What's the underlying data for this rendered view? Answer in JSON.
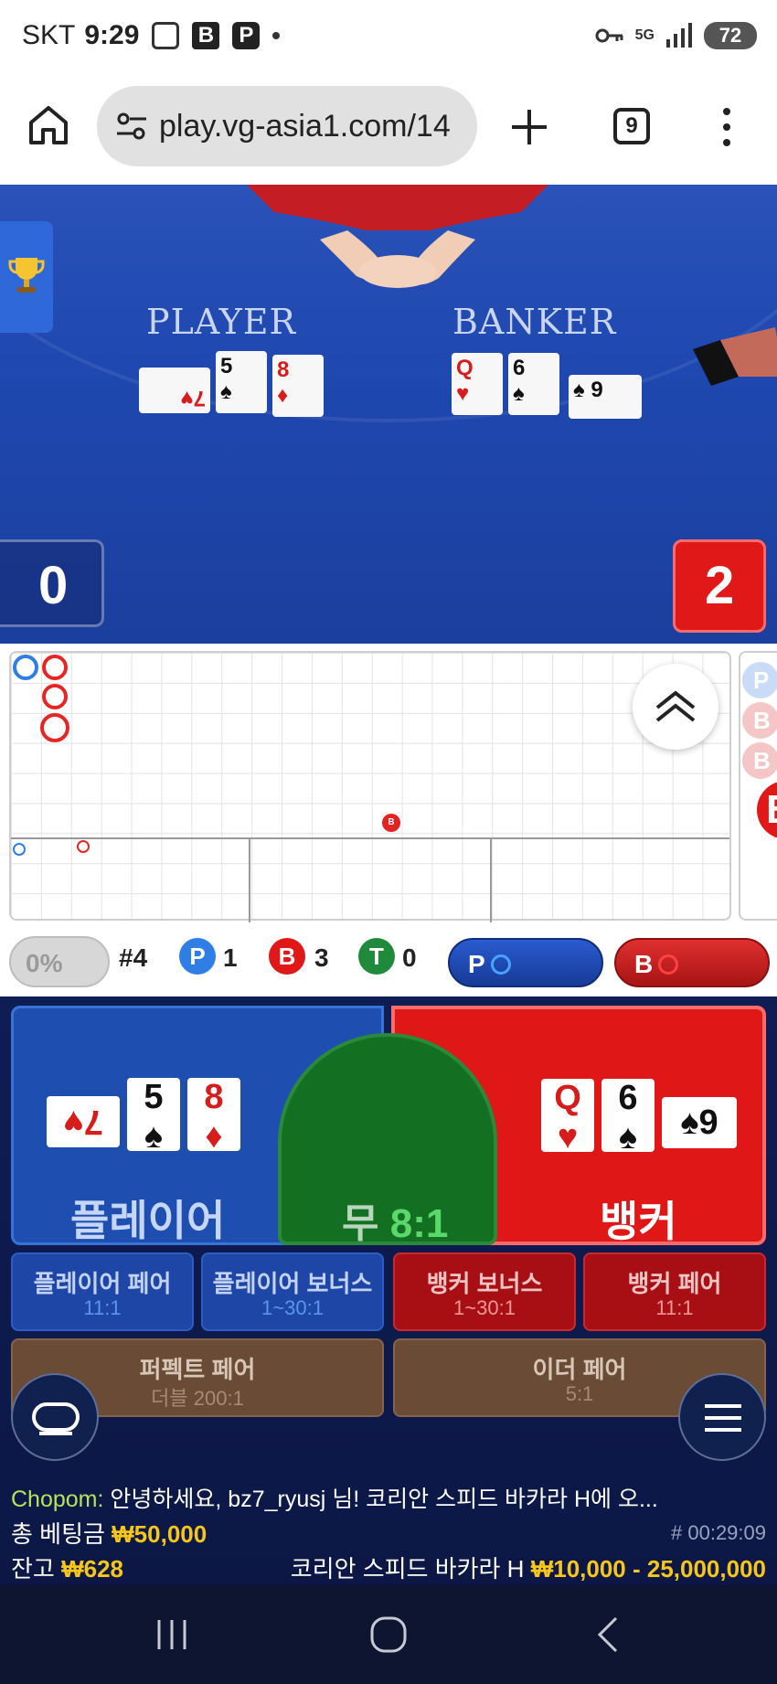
{
  "status_bar": {
    "carrier": "SKT",
    "time": "9:29",
    "b_icon": "B",
    "p_icon": "P",
    "network": "5G",
    "battery": "72"
  },
  "browser": {
    "url": "play.vg-asia1.com/14",
    "tab_count": "9"
  },
  "video": {
    "player_label": "PLAYER",
    "banker_label": "BANKER",
    "player_score": "0",
    "banker_score": "2",
    "player_cards": [
      {
        "rank": "7",
        "suit": "♥",
        "color": "red"
      },
      {
        "rank": "5",
        "suit": "♠",
        "color": "black"
      },
      {
        "rank": "8",
        "suit": "♦",
        "color": "red"
      }
    ],
    "banker_cards": [
      {
        "rank": "Q",
        "suit": "♥",
        "color": "red"
      },
      {
        "rank": "6",
        "suit": "♠",
        "color": "black"
      },
      {
        "rank": "9",
        "suit": "♠",
        "color": "black"
      }
    ]
  },
  "roadmap": {
    "stats": {
      "percent": "0%",
      "round": "#4",
      "p_label": "P",
      "p_count": "1",
      "b_label": "B",
      "b_count": "3",
      "t_label": "T",
      "t_count": "0"
    },
    "predict_player": "P",
    "predict_banker": "B",
    "side_labels": [
      "P",
      "B",
      "B"
    ],
    "big_b": "B",
    "bead_b": "B"
  },
  "betting": {
    "player_label": "플레이어",
    "banker_label": "뱅커",
    "tie_label": "무",
    "tie_odds": "8:1",
    "player_cards": [
      {
        "rank": "7",
        "suit": "♥",
        "color": "red"
      },
      {
        "rank": "5",
        "suit": "♠",
        "color": "black"
      },
      {
        "rank": "8",
        "suit": "♦",
        "color": "red"
      }
    ],
    "banker_cards": [
      {
        "rank": "Q",
        "suit": "♥",
        "color": "red"
      },
      {
        "rank": "6",
        "suit": "♠",
        "color": "black"
      },
      {
        "rank": "9",
        "suit": "♠",
        "color": "black"
      }
    ],
    "side_bets": [
      {
        "title": "플레이어 페어",
        "odds": "11:1"
      },
      {
        "title": "플레이어 보너스",
        "odds": "1~30:1"
      },
      {
        "title": "뱅커 보너스",
        "odds": "1~30:1"
      },
      {
        "title": "뱅커 페어",
        "odds": "11:1"
      }
    ],
    "perfect_pair": {
      "title": "퍼펙트 페어",
      "odds": "더블 200:1"
    },
    "either_pair": {
      "title": "이더 페어",
      "odds": "5:1"
    }
  },
  "footer": {
    "chat_nick": "Chopom:",
    "chat_msg": "안녕하세요, bz7_ryusj 님! 코리안 스피드 바카라 H에 오...",
    "total_bet_label": "총 베팅금",
    "total_bet": "₩50,000",
    "timer": "# 00:29:09",
    "balance_label": "잔고",
    "balance": "₩628",
    "table_name": "코리안 스피드 바카라 H",
    "limits": "₩10,000 - 25,000,000"
  },
  "colors": {
    "player_blue": "#1e4fb0",
    "banker_red": "#e01717",
    "tie_green": "#137022",
    "amount_yellow": "#f6c71a"
  }
}
